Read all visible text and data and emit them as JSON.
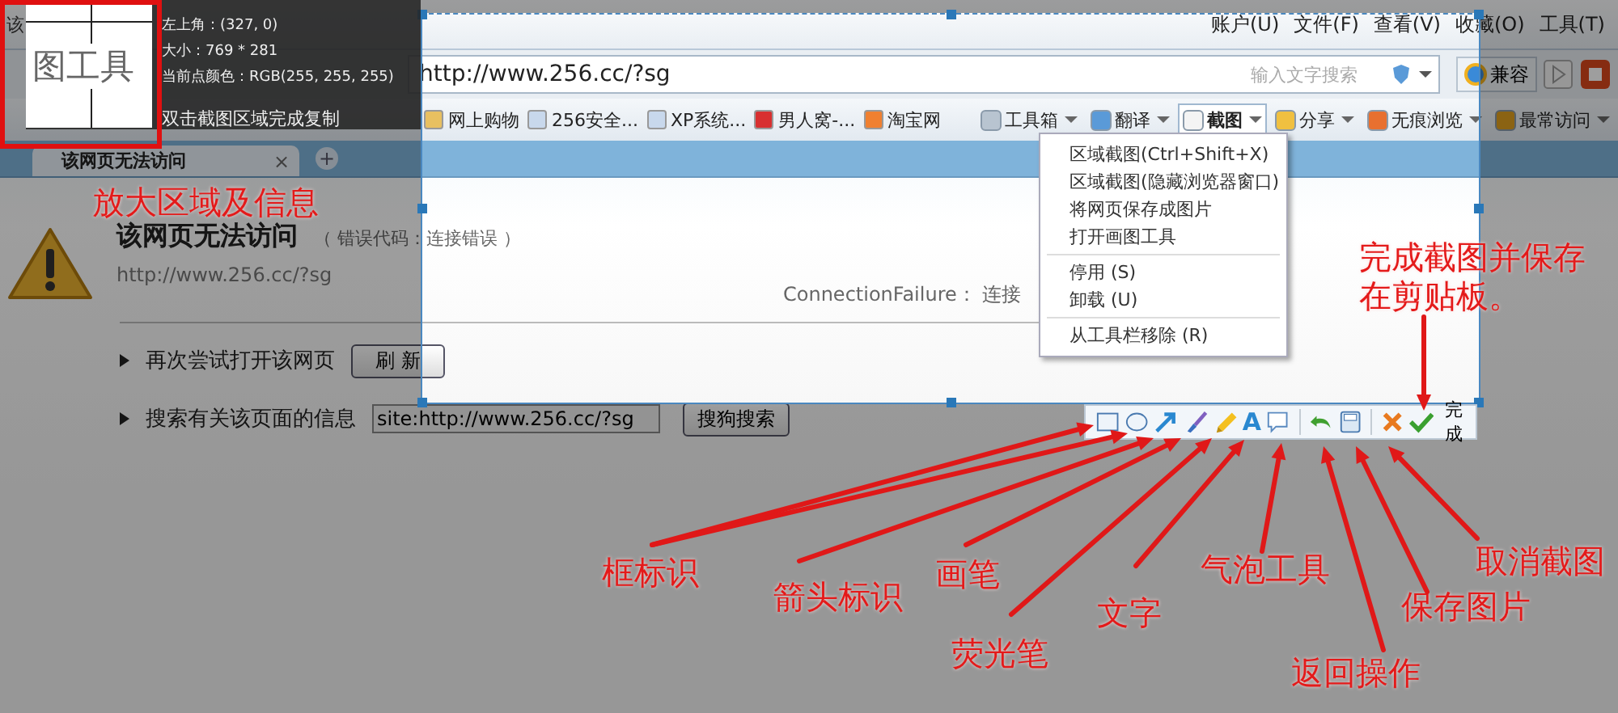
{
  "window": {
    "title_fragment": "该"
  },
  "menu_bar": [
    "账户(U)",
    "文件(F)",
    "查看(V)",
    "收藏(O)",
    "工具(T)"
  ],
  "address_bar": {
    "url": "http://www.256.cc/?sg"
  },
  "search": {
    "placeholder": "输入文字搜索"
  },
  "compat_button": "兼容",
  "bookmarks": [
    {
      "label": "网上购物",
      "kind": "folder"
    },
    {
      "label": "256安全...",
      "kind": "page"
    },
    {
      "label": "XP系统...",
      "kind": "page"
    },
    {
      "label": "男人窝-...",
      "kind": "brand"
    },
    {
      "label": "淘宝网",
      "kind": "shop"
    }
  ],
  "tools": [
    {
      "label": "工具箱",
      "kind": "toolbox",
      "pressed": false
    },
    {
      "label": "翻译",
      "kind": "translate",
      "pressed": false
    },
    {
      "label": "截图",
      "kind": "capture",
      "pressed": true
    },
    {
      "label": "分享",
      "kind": "share",
      "pressed": false
    },
    {
      "label": "无痕浏览",
      "kind": "private",
      "pressed": false
    },
    {
      "label": "最常访问",
      "kind": "frequent",
      "pressed": false
    }
  ],
  "tab": {
    "label": "该网页无法访问",
    "close": "×",
    "new_tab": "+"
  },
  "error_page": {
    "title": "该网页无法访问",
    "code": "（ 错误代码：连接错误 ）",
    "url": "http://www.256.cc/?sg",
    "detail": "ConnectionFailure： 连接",
    "actions": [
      {
        "kind": "retry",
        "text": "再次尝试打开该网页",
        "button": "刷 新"
      },
      {
        "kind": "search",
        "text": "搜索有关该页面的信息",
        "value": "site:http://www.256.cc/?sg",
        "button": "搜狗搜索"
      }
    ]
  },
  "magnifier": {
    "preview": "图工具",
    "info": [
      "左上角：(327, 0)",
      "大小：769 * 281",
      "当前点颜色：RGB(255, 255, 255)"
    ],
    "hint": "双击截图区域完成复制"
  },
  "capture_menu": {
    "groups": [
      [
        "区域截图(Ctrl+Shift+X)",
        "区域截图(隐藏浏览器窗口)",
        "将网页保存成图片",
        "打开画图工具"
      ],
      [
        "停用 (S)",
        "卸载 (U)"
      ],
      [
        "从工具栏移除 (R)"
      ]
    ]
  },
  "capture_toolbar": {
    "tools": [
      {
        "kind": "rectangle"
      },
      {
        "kind": "ellipse"
      },
      {
        "kind": "arrow"
      },
      {
        "kind": "brush"
      },
      {
        "kind": "highlighter"
      },
      {
        "kind": "text",
        "glyph": "A"
      },
      {
        "kind": "bubble"
      },
      {
        "kind": "undo"
      },
      {
        "kind": "save"
      },
      {
        "kind": "cancel"
      },
      {
        "kind": "done"
      }
    ],
    "done_label": "完成"
  },
  "annotations": [
    {
      "text": "放大区域及信息"
    },
    {
      "text": "完成截图并保存在剪贴板。"
    },
    {
      "text": "框标识"
    },
    {
      "text": "箭头标识"
    },
    {
      "text": "画笔"
    },
    {
      "text": "荧光笔"
    },
    {
      "text": "文字"
    },
    {
      "text": "气泡工具"
    },
    {
      "text": "返回操作"
    },
    {
      "text": "保存图片"
    },
    {
      "text": "取消截图"
    }
  ]
}
